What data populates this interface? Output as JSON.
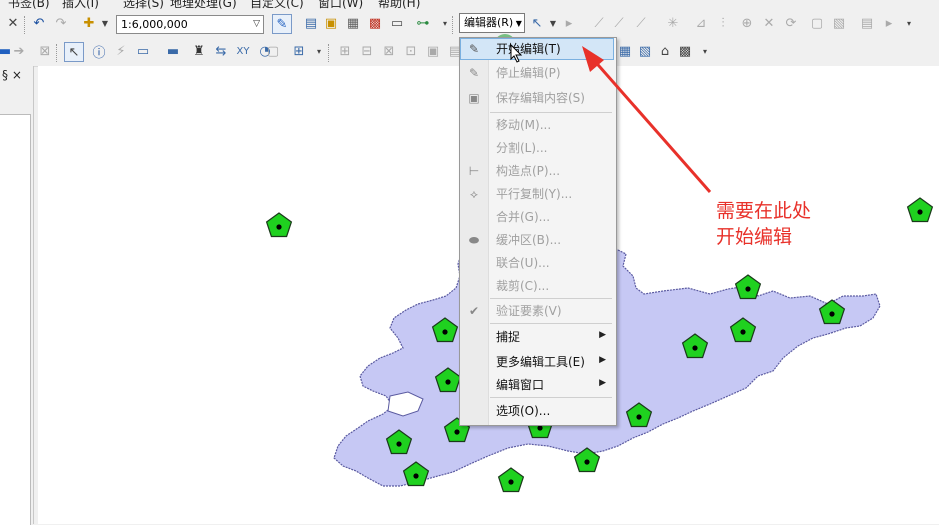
{
  "menubar": {
    "items": [
      "书签(B)",
      "插入(I)",
      "选择(S)",
      "地理处理(G)",
      "自定义(C)",
      "窗口(W)",
      "帮助(H)"
    ]
  },
  "toolbar": {
    "scale_value": "1:6,000,000",
    "editor_label": "编辑器(R)"
  },
  "panel": {
    "header": "§ ×"
  },
  "editor_menu": {
    "items": [
      {
        "label": "开始编辑(T)",
        "icon": "pencil-icon",
        "enabled": true,
        "highlighted": true
      },
      {
        "label": "停止编辑(P)",
        "icon": "stop-edit-icon",
        "enabled": false
      },
      {
        "label": "保存编辑内容(S)",
        "icon": "save-edits-icon",
        "enabled": false
      },
      {
        "label": "移动(M)...",
        "enabled": false
      },
      {
        "label": "分割(L)...",
        "enabled": false
      },
      {
        "label": "构造点(P)...",
        "icon": "construct-points-icon",
        "enabled": false
      },
      {
        "label": "平行复制(Y)...",
        "icon": "copy-parallel-icon",
        "enabled": false
      },
      {
        "label": "合并(G)...",
        "enabled": false
      },
      {
        "label": "缓冲区(B)...",
        "icon": "buffer-icon",
        "enabled": false
      },
      {
        "label": "联合(U)...",
        "enabled": false
      },
      {
        "label": "裁剪(C)...",
        "enabled": false
      },
      {
        "label": "验证要素(V)",
        "icon": "validate-icon",
        "enabled": false
      },
      {
        "label": "捕捉",
        "enabled": true,
        "submenu": true
      },
      {
        "label": "更多编辑工具(E)",
        "enabled": true,
        "submenu": true
      },
      {
        "label": "编辑窗口",
        "enabled": true,
        "submenu": true
      },
      {
        "label": "选项(O)...",
        "enabled": true
      }
    ]
  },
  "annotation": {
    "line1": "需要在此处",
    "line2": "开始编辑",
    "color": "#e8312a"
  },
  "colors": {
    "province_fill": "#c6c8f4",
    "point_fill": "#1fd11f",
    "highlight": "#d3e6f7"
  }
}
